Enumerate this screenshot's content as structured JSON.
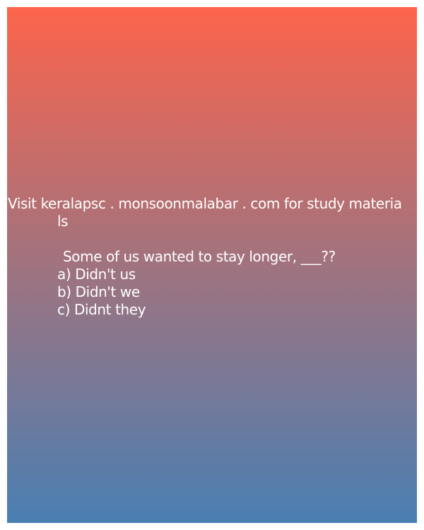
{
  "card": {
    "promo": {
      "line1": "Visit keralapsc . monsoonmalabar . com for study materia",
      "line2": "ls"
    },
    "question": "Some of us wanted to stay longer, ___??",
    "options": [
      "a) Didn't us",
      "b) Didn't we",
      "c) Didnt they"
    ]
  },
  "colors": {
    "gradient_top": "#fd644b",
    "gradient_middle": "#a0737f",
    "gradient_bottom": "#4a7fb2",
    "text": "#ffffff"
  }
}
